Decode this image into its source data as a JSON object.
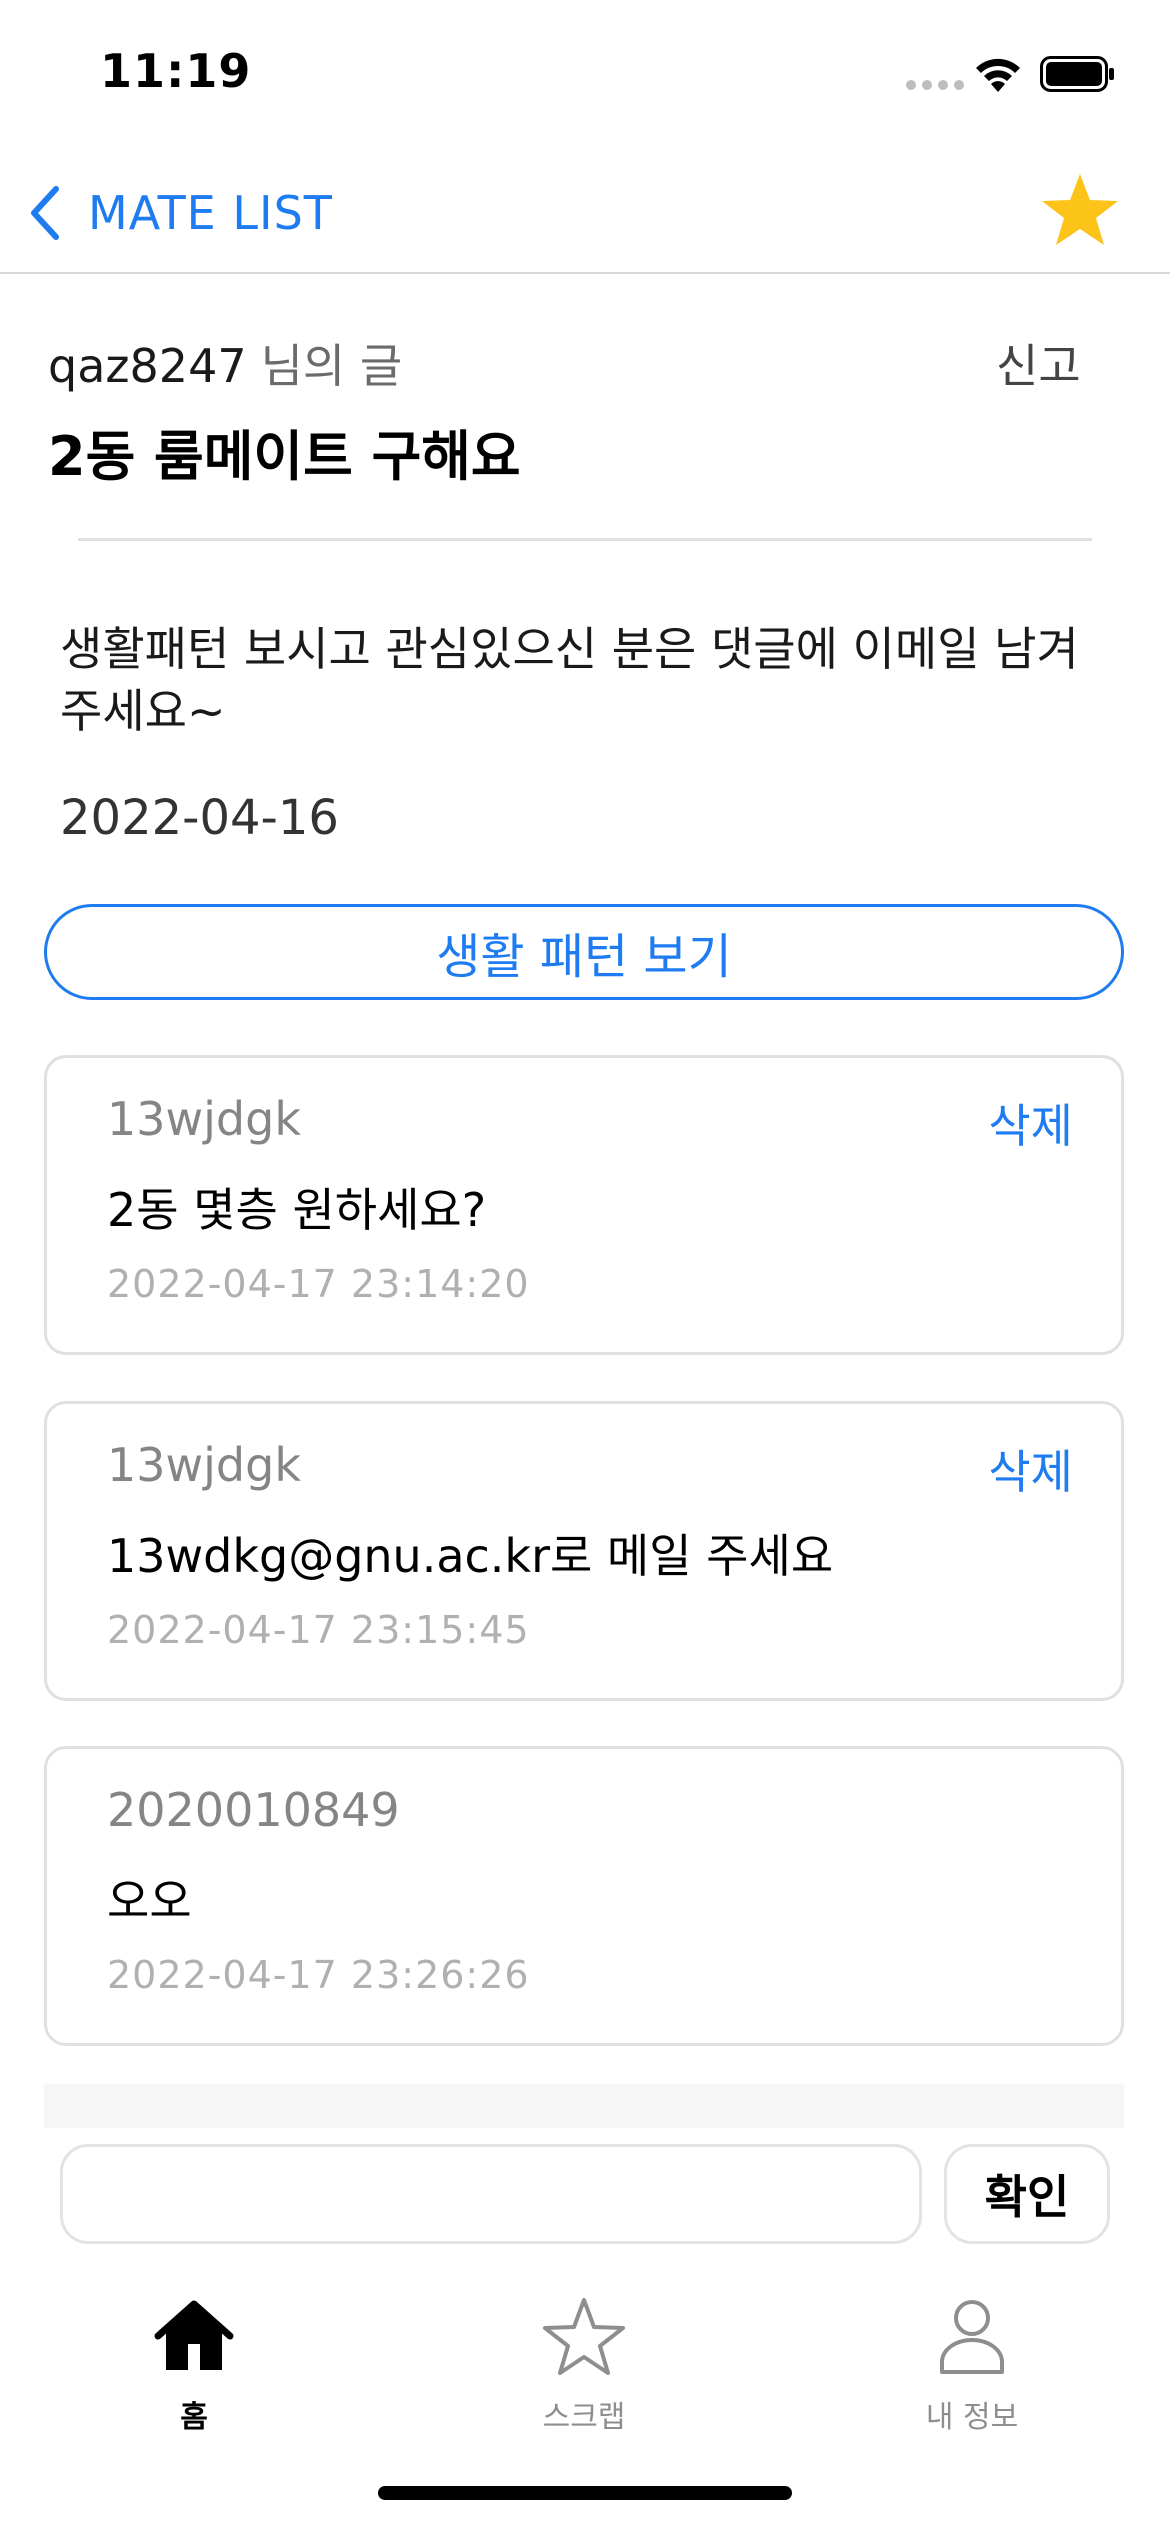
{
  "status_bar": {
    "time": "11:19"
  },
  "nav": {
    "back_label": "MATE LIST",
    "scrap_icon": "star-filled-icon",
    "accent_color": "#1e7cf0",
    "star_color": "#fcc419"
  },
  "post": {
    "author": "qaz8247",
    "author_suffix": "님의 글",
    "report_label": "신고",
    "title": "2동 룸메이트 구해요",
    "body": "생활패턴 보시고 관심있으신 분은 댓글에 이메일 남겨주세요~",
    "date": "2022-04-16",
    "pattern_button_label": "생활 패턴 보기"
  },
  "comments": [
    {
      "author": "13wjdgk",
      "text": "2동 몇층 원하세요?",
      "time": "2022-04-17 23:14:20",
      "delete_label": "삭제"
    },
    {
      "author": "13wjdgk",
      "text": "13wdkg@gnu.ac.kr로 메일 주세요",
      "time": "2022-04-17 23:15:45",
      "delete_label": "삭제"
    },
    {
      "author": "2020010849",
      "text": "오오",
      "time": "2022-04-17 23:26:26",
      "delete_label": ""
    }
  ],
  "comment_input": {
    "value": "",
    "placeholder": "",
    "confirm_label": "확인"
  },
  "tab_bar": {
    "items": [
      {
        "label": "홈",
        "icon": "home-icon",
        "active": true
      },
      {
        "label": "스크랩",
        "icon": "star-outline-icon",
        "active": false
      },
      {
        "label": "내 정보",
        "icon": "person-icon",
        "active": false
      }
    ]
  }
}
